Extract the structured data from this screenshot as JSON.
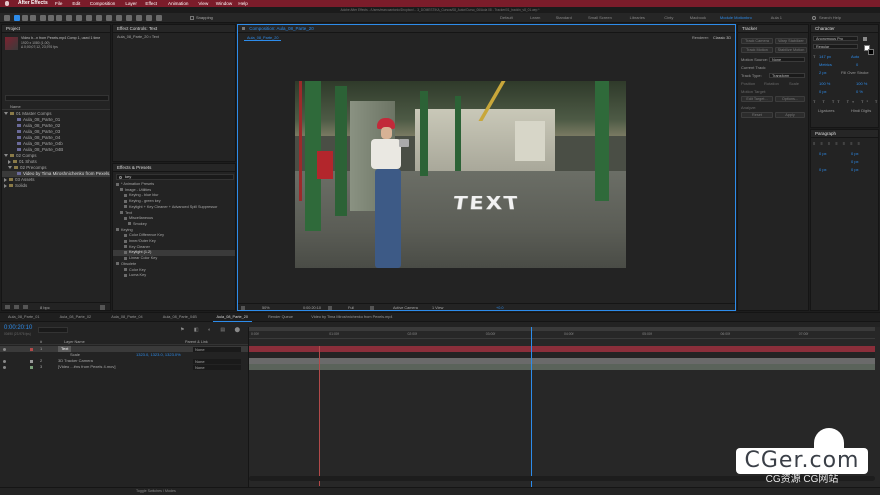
{
  "title_bar": {
    "app_name": "After Effects",
    "menus": [
      "File",
      "Edit",
      "Composition",
      "Layer",
      "Effect",
      "Animation",
      "View",
      "Window",
      "Help"
    ],
    "window_title": "Adobe After Effects - /Users/marcoantonio/Dropbox/...  3_DOMESTIKA_Cursos/08_Autor/Curso_06/Aula 08 - Tracker/01_trackin_v8_01.aep *"
  },
  "toolbar": {
    "snapping_label": "Snapping"
  },
  "workspaces": {
    "items": [
      "Default",
      "Learn",
      "Standard",
      "Small Screen",
      "Libraries",
      "Cinty",
      "Macbook",
      "Module Motionbro",
      "Aula 1"
    ],
    "active": "Module Motionbro",
    "search_placeholder": "Search Help"
  },
  "project_panel": {
    "tab": "Project",
    "effect_controls_tab": "Effect Controls: Text",
    "effect_controls_sub": "Aula_08_Parte_20 • Text",
    "preview_name": "Video b...n from Pexels.mp4 Comp 1, used 1 time",
    "preview_info1": "1920 x 1080 (1,00)",
    "preview_info2": "Δ 0;00;07;12, 23,976 fps",
    "search_placeholder": "",
    "col_name": "Name",
    "items": [
      {
        "label": "01 Master Comps",
        "kind": "folder",
        "indent": 0,
        "open": true
      },
      {
        "label": "Aula_08_Parte_01",
        "kind": "comp",
        "indent": 2,
        "open": false
      },
      {
        "label": "Aula_08_Parte_02",
        "kind": "comp",
        "indent": 2,
        "open": false
      },
      {
        "label": "Aula_08_Parte_03",
        "kind": "comp",
        "indent": 2,
        "open": false
      },
      {
        "label": "Aula_08_Parte_04",
        "kind": "comp",
        "indent": 2,
        "open": false
      },
      {
        "label": "Aula_08_Parte_04b",
        "kind": "comp",
        "indent": 2,
        "open": false
      },
      {
        "label": "Aula_08_Parte_04B",
        "kind": "comp",
        "indent": 2,
        "open": false
      },
      {
        "label": "02 Comps",
        "kind": "folder",
        "indent": 0,
        "open": true
      },
      {
        "label": "01 Shots",
        "kind": "folder",
        "indent": 1,
        "open": false
      },
      {
        "label": "02 Precomps",
        "kind": "folder",
        "indent": 1,
        "open": true
      },
      {
        "label": "Video by Tima Miroshnichenko from Pexels.mp4",
        "kind": "comp",
        "indent": 2,
        "open": false,
        "selected": true
      },
      {
        "label": "03 Assets",
        "kind": "folder",
        "indent": 0,
        "open": false
      },
      {
        "label": "Solids",
        "kind": "folder",
        "indent": 0,
        "open": false
      }
    ],
    "bpc": "8 bpc"
  },
  "effects_panel": {
    "tab": "Effects & Presets",
    "search_value": "key",
    "items": [
      {
        "label": "* Animation Presets",
        "indent": 0
      },
      {
        "label": "Image - Utilities",
        "indent": 1
      },
      {
        "label": "Keying - blue blur",
        "indent": 2
      },
      {
        "label": "Keying - green key",
        "indent": 2
      },
      {
        "label": "Keylight + Key Cleaner + Advanced Spill Suppressor",
        "indent": 2
      },
      {
        "label": "Text",
        "indent": 1
      },
      {
        "label": "Miscellaneous",
        "indent": 2
      },
      {
        "label": "Smokey",
        "indent": 3
      },
      {
        "label": "Keying",
        "indent": 0
      },
      {
        "label": "Color Difference Key",
        "indent": 2
      },
      {
        "label": "Inner/Outer Key",
        "indent": 2
      },
      {
        "label": "Key Cleaner",
        "indent": 2
      },
      {
        "label": "Keylight (1.2)",
        "indent": 2,
        "selected": true
      },
      {
        "label": "Linear Color Key",
        "indent": 2
      },
      {
        "label": "Obsolete",
        "indent": 0
      },
      {
        "label": "Color Key",
        "indent": 2
      },
      {
        "label": "Luma Key",
        "indent": 2
      }
    ]
  },
  "composition_panel": {
    "tab": "Composition: Aula_08_Parte_20",
    "sub_tab": "Aula_08_Parte_20",
    "renderer_label": "Renderer:",
    "renderer_value": "Classic 3D",
    "overlay_text": "TEXT",
    "footer": {
      "zoom": "50%",
      "timecode": "0:00:20:10",
      "resolution": "Full",
      "camera": "Active Camera",
      "views": "1 View",
      "offset": "+0.0"
    }
  },
  "tracker_panel": {
    "tab": "Tracker",
    "buttons": [
      "Track Camera",
      "Warp Stabilizer",
      "Track Motion",
      "Stabilize Motion"
    ],
    "motion_source_label": "Motion Source:",
    "motion_source_value": "None",
    "current_track_label": "Current Track:",
    "track_type_label": "Track Type:",
    "track_type_value": "Transform",
    "checkboxes": [
      "Position",
      "Rotation",
      "Scale"
    ],
    "motion_target_label": "Motion Target:",
    "edit_target": "Edit Target...",
    "options": "Options...",
    "analyze_label": "Analyze:",
    "reset": "Reset",
    "apply": "Apply"
  },
  "character_panel": {
    "tab": "Character",
    "font": "Anonymous Pro",
    "style": "Regular",
    "size": "147 px",
    "leading": "Auto",
    "kerning": "Metrics",
    "tracking": "0",
    "stroke_width": "2 px",
    "stroke_type": "Fill Over Stroke",
    "v_scale": "100 %",
    "h_scale": "100 %",
    "baseline": "0 px",
    "tsume": "0 %",
    "ligatures": "Ligatures",
    "hindi_digits": "Hindi Digits"
  },
  "paragraph_panel": {
    "tab": "Paragraph",
    "indents": [
      "0 px",
      "0 px",
      "0 px",
      "0 px",
      "0 px"
    ]
  },
  "timeline": {
    "tabs": [
      "Aula_08_Parte_01",
      "Aula_08_Parte_02",
      "Aula_08_Parte_04",
      "Aula_08_Parte_04B",
      "Aula_08_Parte_20",
      "Render Queue",
      "Video by Tima Miroshnichenko from Pexels.mp4"
    ],
    "active_tab": "Aula_08_Parte_20",
    "timecode": "0:00:20:10",
    "frame_info": "00490 (23.976 fps)",
    "col_headers": [
      "#",
      "Layer Name",
      "Parent & Link"
    ],
    "layers": [
      {
        "num": "1",
        "name": "Text",
        "kind": "text",
        "parent": "None",
        "color": "#b24a4a",
        "selected": true
      },
      {
        "num": "",
        "name": "Scale",
        "kind": "prop",
        "parent": "",
        "value": "1323.0, 1323.0, 1323.0%",
        "color": ""
      },
      {
        "num": "2",
        "name": "3D Tracker Camera",
        "kind": "cam",
        "parent": "None",
        "color": "#9a9a9a"
      },
      {
        "num": "3",
        "name": "[Video ...ëns from Pexels 4.mov]",
        "kind": "video",
        "parent": "None",
        "color": "#7aa07a"
      }
    ],
    "ruler_labels": [
      "0:00f",
      "01:00f",
      "02:00f",
      "03:00f",
      "04:00f",
      "05:00f",
      "06:00f",
      "07:00f"
    ],
    "footer_label": "Toggle Switches / Modes",
    "current_time_fraction": 0.45
  },
  "watermark": {
    "brand": "CGer.com",
    "sub": "CG资源 CG网站"
  }
}
